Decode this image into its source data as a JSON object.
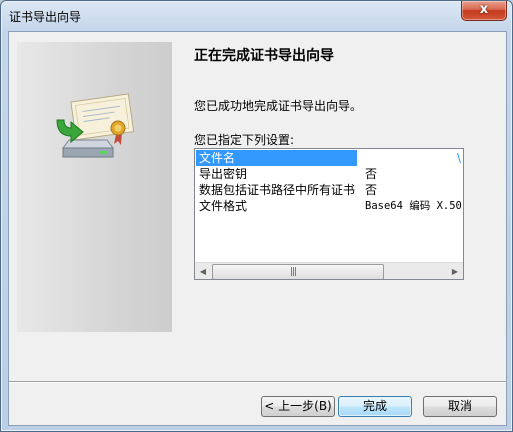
{
  "window": {
    "title": "证书导出向导",
    "close_glyph": "x"
  },
  "icons": {
    "close": "close-icon",
    "wizard": "certificate-export-icon"
  },
  "wizard": {
    "heading": "正在完成证书导出向导",
    "success_text": "您已成功地完成证书导出向导。",
    "settings_label": "您已指定下列设置:",
    "settings": [
      {
        "key": "文件名",
        "value": "\\"
      },
      {
        "key": "导出密钥",
        "value": "否"
      },
      {
        "key": "数据包括证书路径中所有证书",
        "value": "否"
      },
      {
        "key": "文件格式",
        "value": "Base64 编码 X.50"
      }
    ],
    "scroll": {
      "left_arrow": "◀",
      "right_arrow": "▶",
      "grip": "|||"
    }
  },
  "buttons": {
    "back": "< 上一步(B)",
    "finish": "完成",
    "cancel": "取消"
  },
  "colors": {
    "selection": "#3399ff",
    "close_red": "#c4391d",
    "default_button_border": "#3c7fb1"
  }
}
